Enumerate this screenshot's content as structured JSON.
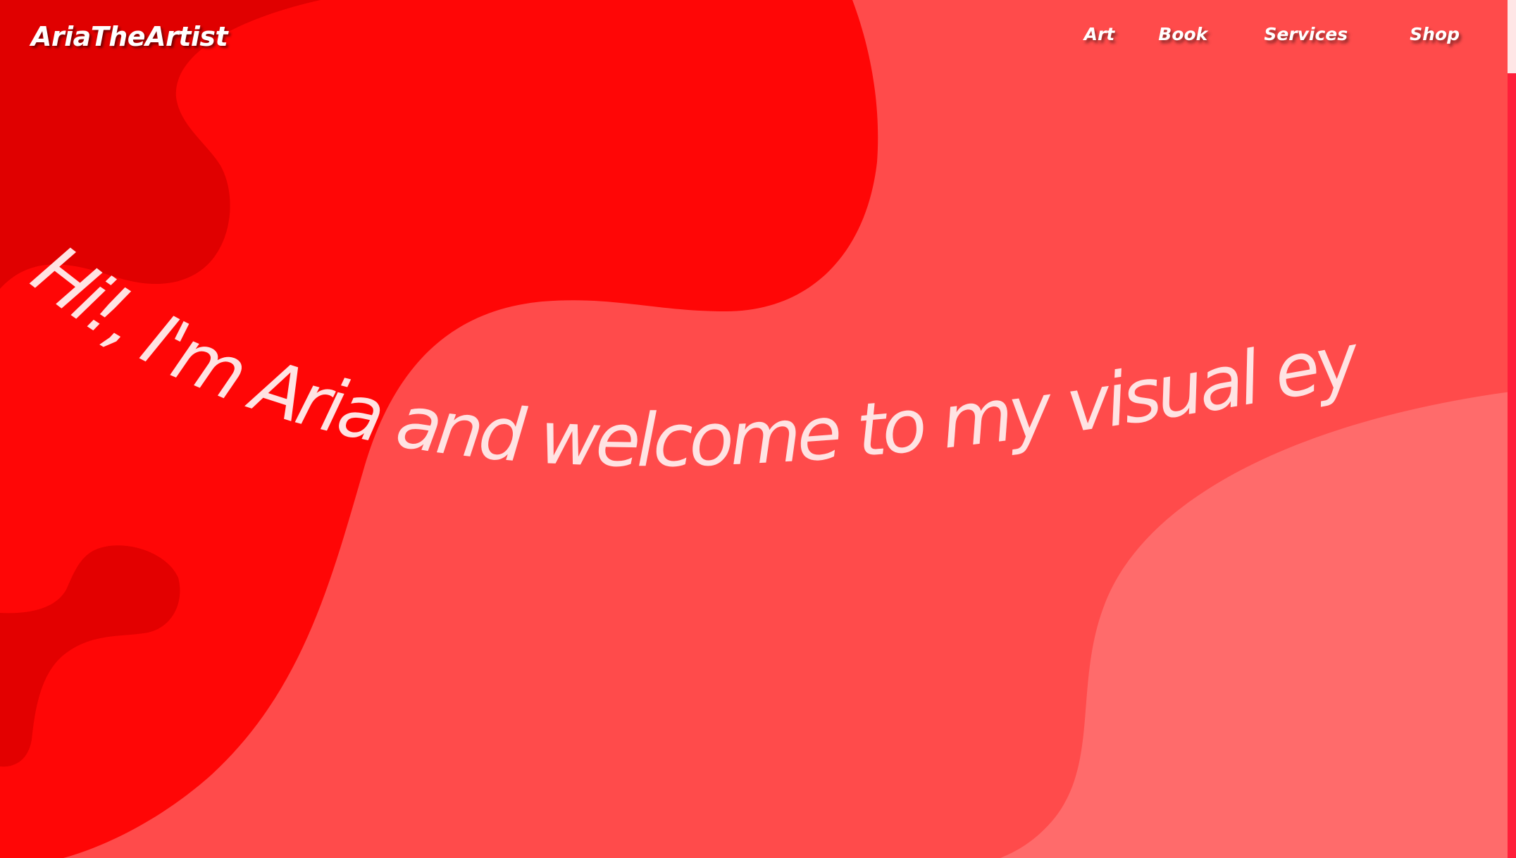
{
  "brand": {
    "name": "AriaTheArtist"
  },
  "nav": {
    "art": "Art",
    "book": "Book",
    "services": "Services",
    "shop": "Shop"
  },
  "hero": {
    "greeting": "Hi!, I'm Aria and welcome to my visual eye"
  },
  "colors": {
    "blob_dark": "#e00000",
    "blob_bright": "#ff0606",
    "background": "#ff4b4b",
    "blob_light": "#ff6b6b",
    "hero_text": "#ffe3e3",
    "scrollbar_track": "#ff1f3a",
    "scrollbar_thumb": "#ffe6e6"
  }
}
